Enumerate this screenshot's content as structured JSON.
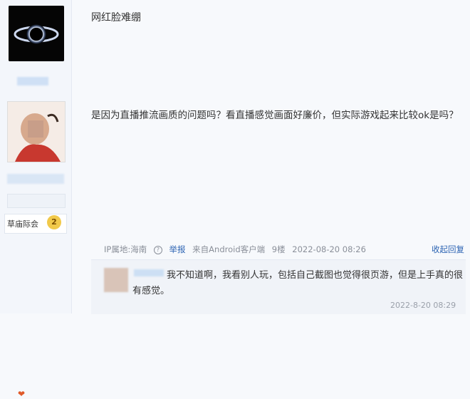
{
  "post": {
    "title": "网红脸难绷",
    "body": "是因为直播推流画质的问题吗？看直播感觉画面好廉价，但实际游戏起来比较ok是吗？",
    "meta": {
      "ip": "IP属地:海南",
      "report_label": "举报",
      "source": "来自Android客户端",
      "floor": "9楼",
      "time": "2022-08-20 08:26",
      "reply_fold": "收起回复"
    }
  },
  "sidebar": {
    "grade_label": "草庙际会",
    "grade_value": "2"
  },
  "reply": {
    "text": "我不知道啊，我看别人玩，包括自己截图也觉得很页游，但是上手真的很有感觉。",
    "time": "2022-8-20 08:29"
  }
}
